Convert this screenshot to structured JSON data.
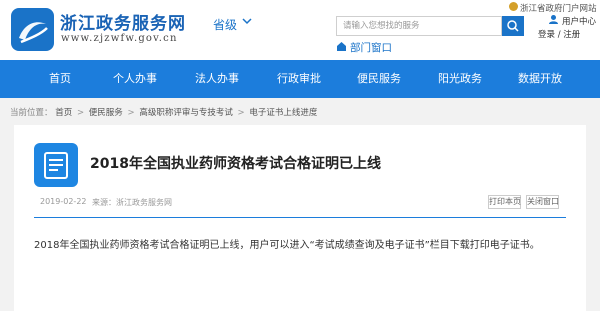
{
  "header": {
    "site_title": "浙江政务服务网",
    "site_url": "www.zjzwfw.gov.cn",
    "region_label": "省级",
    "search_placeholder": "请输入您想找的服务",
    "dept_window_label": "部门窗口",
    "portal_label": "浙江省政府门户网站",
    "user_center_label": "用户中心",
    "login_label": "登录",
    "login_sep": "/",
    "register_label": "注册"
  },
  "nav": {
    "items": [
      {
        "label": "首页"
      },
      {
        "label": "个人办事"
      },
      {
        "label": "法人办事"
      },
      {
        "label": "行政审批"
      },
      {
        "label": "便民服务"
      },
      {
        "label": "阳光政务"
      },
      {
        "label": "数据开放"
      }
    ]
  },
  "breadcrumb": {
    "prefix": "当前位置：",
    "items": [
      {
        "label": "首页"
      },
      {
        "label": "便民服务"
      },
      {
        "label": "高级职称评审与专技考试"
      },
      {
        "label": "电子证书上线进度"
      }
    ],
    "separator": ">"
  },
  "article": {
    "title": "2018年全国执业药师资格考试合格证明已上线",
    "date": "2019-02-22",
    "source": "来源：浙江政务服务网",
    "print_label": "打印本页",
    "close_label": "关闭窗口",
    "body": "2018年全国执业药师资格考试合格证明已上线，用户可以进入“考试成绩查询及电子证书”栏目下载打印电子证书。"
  },
  "colors": {
    "brand_blue": "#1c7ddc",
    "logo_blue": "#1a73c8"
  }
}
